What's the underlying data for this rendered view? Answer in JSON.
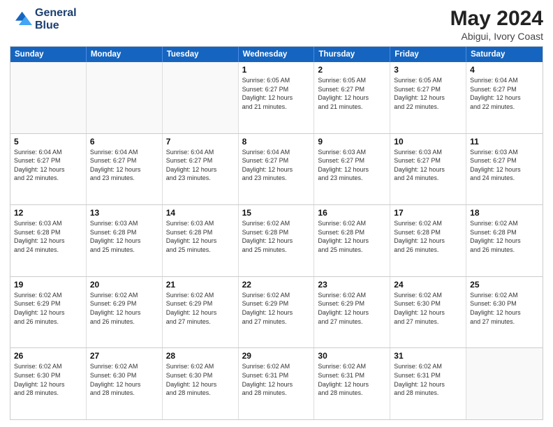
{
  "header": {
    "logo_line1": "General",
    "logo_line2": "Blue",
    "title": "May 2024",
    "subtitle": "Abigui, Ivory Coast"
  },
  "days_of_week": [
    "Sunday",
    "Monday",
    "Tuesday",
    "Wednesday",
    "Thursday",
    "Friday",
    "Saturday"
  ],
  "weeks": [
    [
      {
        "day": "",
        "info": "",
        "empty": true
      },
      {
        "day": "",
        "info": "",
        "empty": true
      },
      {
        "day": "",
        "info": "",
        "empty": true
      },
      {
        "day": "1",
        "info": "Sunrise: 6:05 AM\nSunset: 6:27 PM\nDaylight: 12 hours\nand 21 minutes.",
        "empty": false
      },
      {
        "day": "2",
        "info": "Sunrise: 6:05 AM\nSunset: 6:27 PM\nDaylight: 12 hours\nand 21 minutes.",
        "empty": false
      },
      {
        "day": "3",
        "info": "Sunrise: 6:05 AM\nSunset: 6:27 PM\nDaylight: 12 hours\nand 22 minutes.",
        "empty": false
      },
      {
        "day": "4",
        "info": "Sunrise: 6:04 AM\nSunset: 6:27 PM\nDaylight: 12 hours\nand 22 minutes.",
        "empty": false
      }
    ],
    [
      {
        "day": "5",
        "info": "Sunrise: 6:04 AM\nSunset: 6:27 PM\nDaylight: 12 hours\nand 22 minutes.",
        "empty": false
      },
      {
        "day": "6",
        "info": "Sunrise: 6:04 AM\nSunset: 6:27 PM\nDaylight: 12 hours\nand 23 minutes.",
        "empty": false
      },
      {
        "day": "7",
        "info": "Sunrise: 6:04 AM\nSunset: 6:27 PM\nDaylight: 12 hours\nand 23 minutes.",
        "empty": false
      },
      {
        "day": "8",
        "info": "Sunrise: 6:04 AM\nSunset: 6:27 PM\nDaylight: 12 hours\nand 23 minutes.",
        "empty": false
      },
      {
        "day": "9",
        "info": "Sunrise: 6:03 AM\nSunset: 6:27 PM\nDaylight: 12 hours\nand 23 minutes.",
        "empty": false
      },
      {
        "day": "10",
        "info": "Sunrise: 6:03 AM\nSunset: 6:27 PM\nDaylight: 12 hours\nand 24 minutes.",
        "empty": false
      },
      {
        "day": "11",
        "info": "Sunrise: 6:03 AM\nSunset: 6:27 PM\nDaylight: 12 hours\nand 24 minutes.",
        "empty": false
      }
    ],
    [
      {
        "day": "12",
        "info": "Sunrise: 6:03 AM\nSunset: 6:28 PM\nDaylight: 12 hours\nand 24 minutes.",
        "empty": false
      },
      {
        "day": "13",
        "info": "Sunrise: 6:03 AM\nSunset: 6:28 PM\nDaylight: 12 hours\nand 25 minutes.",
        "empty": false
      },
      {
        "day": "14",
        "info": "Sunrise: 6:03 AM\nSunset: 6:28 PM\nDaylight: 12 hours\nand 25 minutes.",
        "empty": false
      },
      {
        "day": "15",
        "info": "Sunrise: 6:02 AM\nSunset: 6:28 PM\nDaylight: 12 hours\nand 25 minutes.",
        "empty": false
      },
      {
        "day": "16",
        "info": "Sunrise: 6:02 AM\nSunset: 6:28 PM\nDaylight: 12 hours\nand 25 minutes.",
        "empty": false
      },
      {
        "day": "17",
        "info": "Sunrise: 6:02 AM\nSunset: 6:28 PM\nDaylight: 12 hours\nand 26 minutes.",
        "empty": false
      },
      {
        "day": "18",
        "info": "Sunrise: 6:02 AM\nSunset: 6:28 PM\nDaylight: 12 hours\nand 26 minutes.",
        "empty": false
      }
    ],
    [
      {
        "day": "19",
        "info": "Sunrise: 6:02 AM\nSunset: 6:29 PM\nDaylight: 12 hours\nand 26 minutes.",
        "empty": false
      },
      {
        "day": "20",
        "info": "Sunrise: 6:02 AM\nSunset: 6:29 PM\nDaylight: 12 hours\nand 26 minutes.",
        "empty": false
      },
      {
        "day": "21",
        "info": "Sunrise: 6:02 AM\nSunset: 6:29 PM\nDaylight: 12 hours\nand 27 minutes.",
        "empty": false
      },
      {
        "day": "22",
        "info": "Sunrise: 6:02 AM\nSunset: 6:29 PM\nDaylight: 12 hours\nand 27 minutes.",
        "empty": false
      },
      {
        "day": "23",
        "info": "Sunrise: 6:02 AM\nSunset: 6:29 PM\nDaylight: 12 hours\nand 27 minutes.",
        "empty": false
      },
      {
        "day": "24",
        "info": "Sunrise: 6:02 AM\nSunset: 6:30 PM\nDaylight: 12 hours\nand 27 minutes.",
        "empty": false
      },
      {
        "day": "25",
        "info": "Sunrise: 6:02 AM\nSunset: 6:30 PM\nDaylight: 12 hours\nand 27 minutes.",
        "empty": false
      }
    ],
    [
      {
        "day": "26",
        "info": "Sunrise: 6:02 AM\nSunset: 6:30 PM\nDaylight: 12 hours\nand 28 minutes.",
        "empty": false
      },
      {
        "day": "27",
        "info": "Sunrise: 6:02 AM\nSunset: 6:30 PM\nDaylight: 12 hours\nand 28 minutes.",
        "empty": false
      },
      {
        "day": "28",
        "info": "Sunrise: 6:02 AM\nSunset: 6:30 PM\nDaylight: 12 hours\nand 28 minutes.",
        "empty": false
      },
      {
        "day": "29",
        "info": "Sunrise: 6:02 AM\nSunset: 6:31 PM\nDaylight: 12 hours\nand 28 minutes.",
        "empty": false
      },
      {
        "day": "30",
        "info": "Sunrise: 6:02 AM\nSunset: 6:31 PM\nDaylight: 12 hours\nand 28 minutes.",
        "empty": false
      },
      {
        "day": "31",
        "info": "Sunrise: 6:02 AM\nSunset: 6:31 PM\nDaylight: 12 hours\nand 28 minutes.",
        "empty": false
      },
      {
        "day": "",
        "info": "",
        "empty": true
      }
    ]
  ]
}
